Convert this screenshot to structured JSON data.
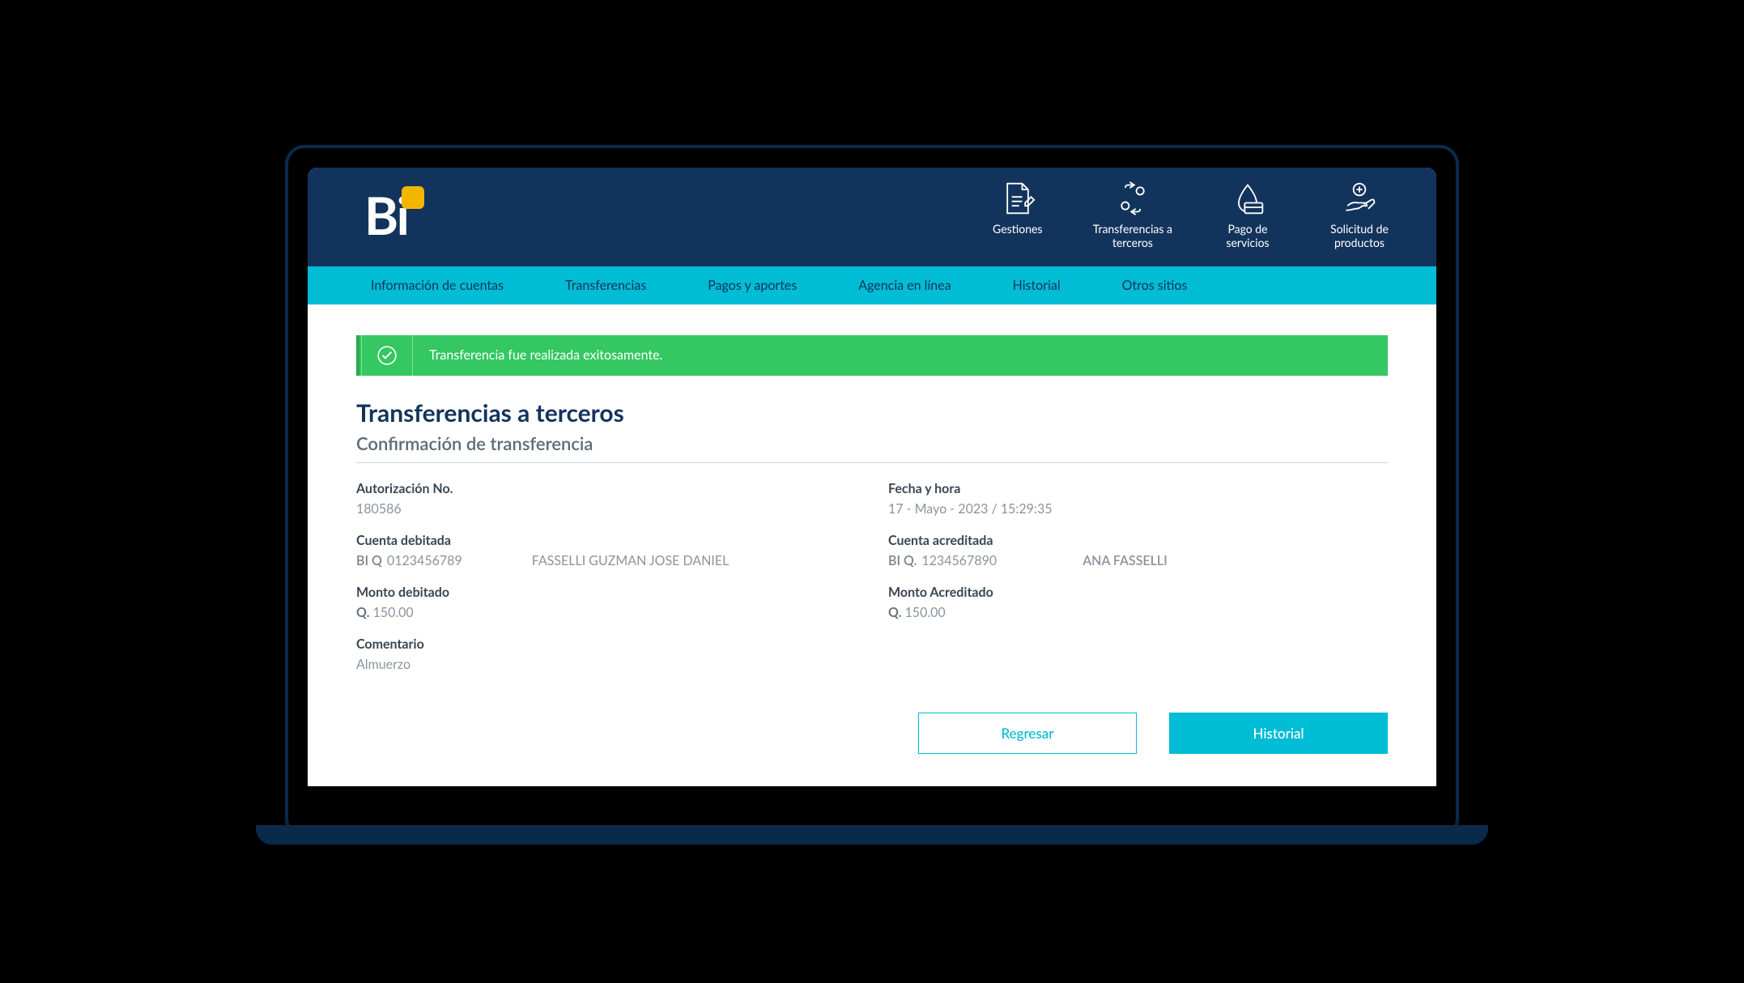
{
  "header": {
    "logo_text": "Bi",
    "icons": [
      {
        "name": "gestiones",
        "label": "Gestiones"
      },
      {
        "name": "transferencias-terceros",
        "label": "Transferencias a\nterceros"
      },
      {
        "name": "pago-servicios",
        "label": "Pago de\nservicios"
      },
      {
        "name": "solicitud-productos",
        "label": "Solicitud de\nproductos"
      }
    ]
  },
  "nav": [
    "Información de cuentas",
    "Transferencias",
    "Pagos y aportes",
    "Agencia en línea",
    "Historial",
    "Otros sitios"
  ],
  "banner": {
    "message": "Transferencia fue realizada exitosamente."
  },
  "page": {
    "title": "Transferencias a terceros",
    "subtitle": "Confirmación de transferencia"
  },
  "details": {
    "auth_label": "Autorización No.",
    "auth_value": "180586",
    "datetime_label": "Fecha y hora",
    "datetime_value": "17 - Mayo - 2023 / 15:29:35",
    "debit_account_label": "Cuenta debitada",
    "debit_account_prefix": "BI Q",
    "debit_account_number": "0123456789",
    "debit_account_name": "FASSELLI GUZMAN JOSE DANIEL",
    "credit_account_label": "Cuenta acreditada",
    "credit_account_prefix": "BI Q.",
    "credit_account_number": "1234567890",
    "credit_account_name": "ANA FASSELLI",
    "debit_amount_label": "Monto debitado",
    "debit_amount_prefix": "Q.",
    "debit_amount_value": "150.00",
    "credit_amount_label": "Monto Acreditado",
    "credit_amount_prefix": "Q.",
    "credit_amount_value": "150.00",
    "comment_label": "Comentario",
    "comment_value": "Almuerzo"
  },
  "actions": {
    "back": "Regresar",
    "history": "Historial"
  }
}
